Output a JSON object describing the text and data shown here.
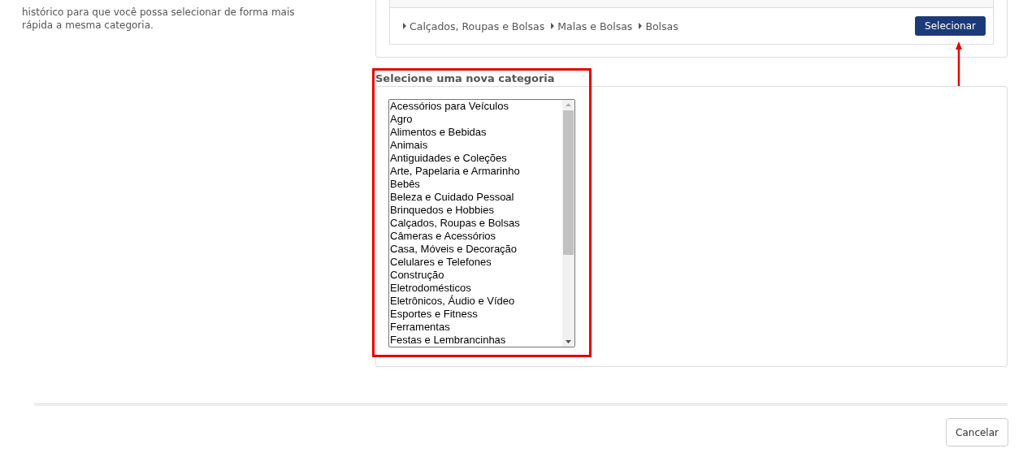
{
  "history_note": "histórico para que você possa selecionar de forma mais rápida a mesma categoria.",
  "history": {
    "path": [
      "Calçados, Roupas e Bolsas",
      "Malas e Bolsas",
      "Bolsas"
    ],
    "button": "Selecionar"
  },
  "new_category": {
    "heading": "Selecione uma nova categoria",
    "options": [
      "Acessórios para Veículos",
      "Agro",
      "Alimentos e Bebidas",
      "Animais",
      "Antiguidades e Coleções",
      "Arte, Papelaria e Armarinho",
      "Bebês",
      "Beleza e Cuidado Pessoal",
      "Brinquedos e Hobbies",
      "Calçados, Roupas e Bolsas",
      "Câmeras e Acessórios",
      "Casa, Móveis e Decoração",
      "Celulares e Telefones",
      "Construção",
      "Eletrodomésticos",
      "Eletrônicos, Áudio e Vídeo",
      "Esportes e Fitness",
      "Ferramentas",
      "Festas e Lembrancinhas"
    ]
  },
  "footer": {
    "cancel": "Cancelar"
  }
}
